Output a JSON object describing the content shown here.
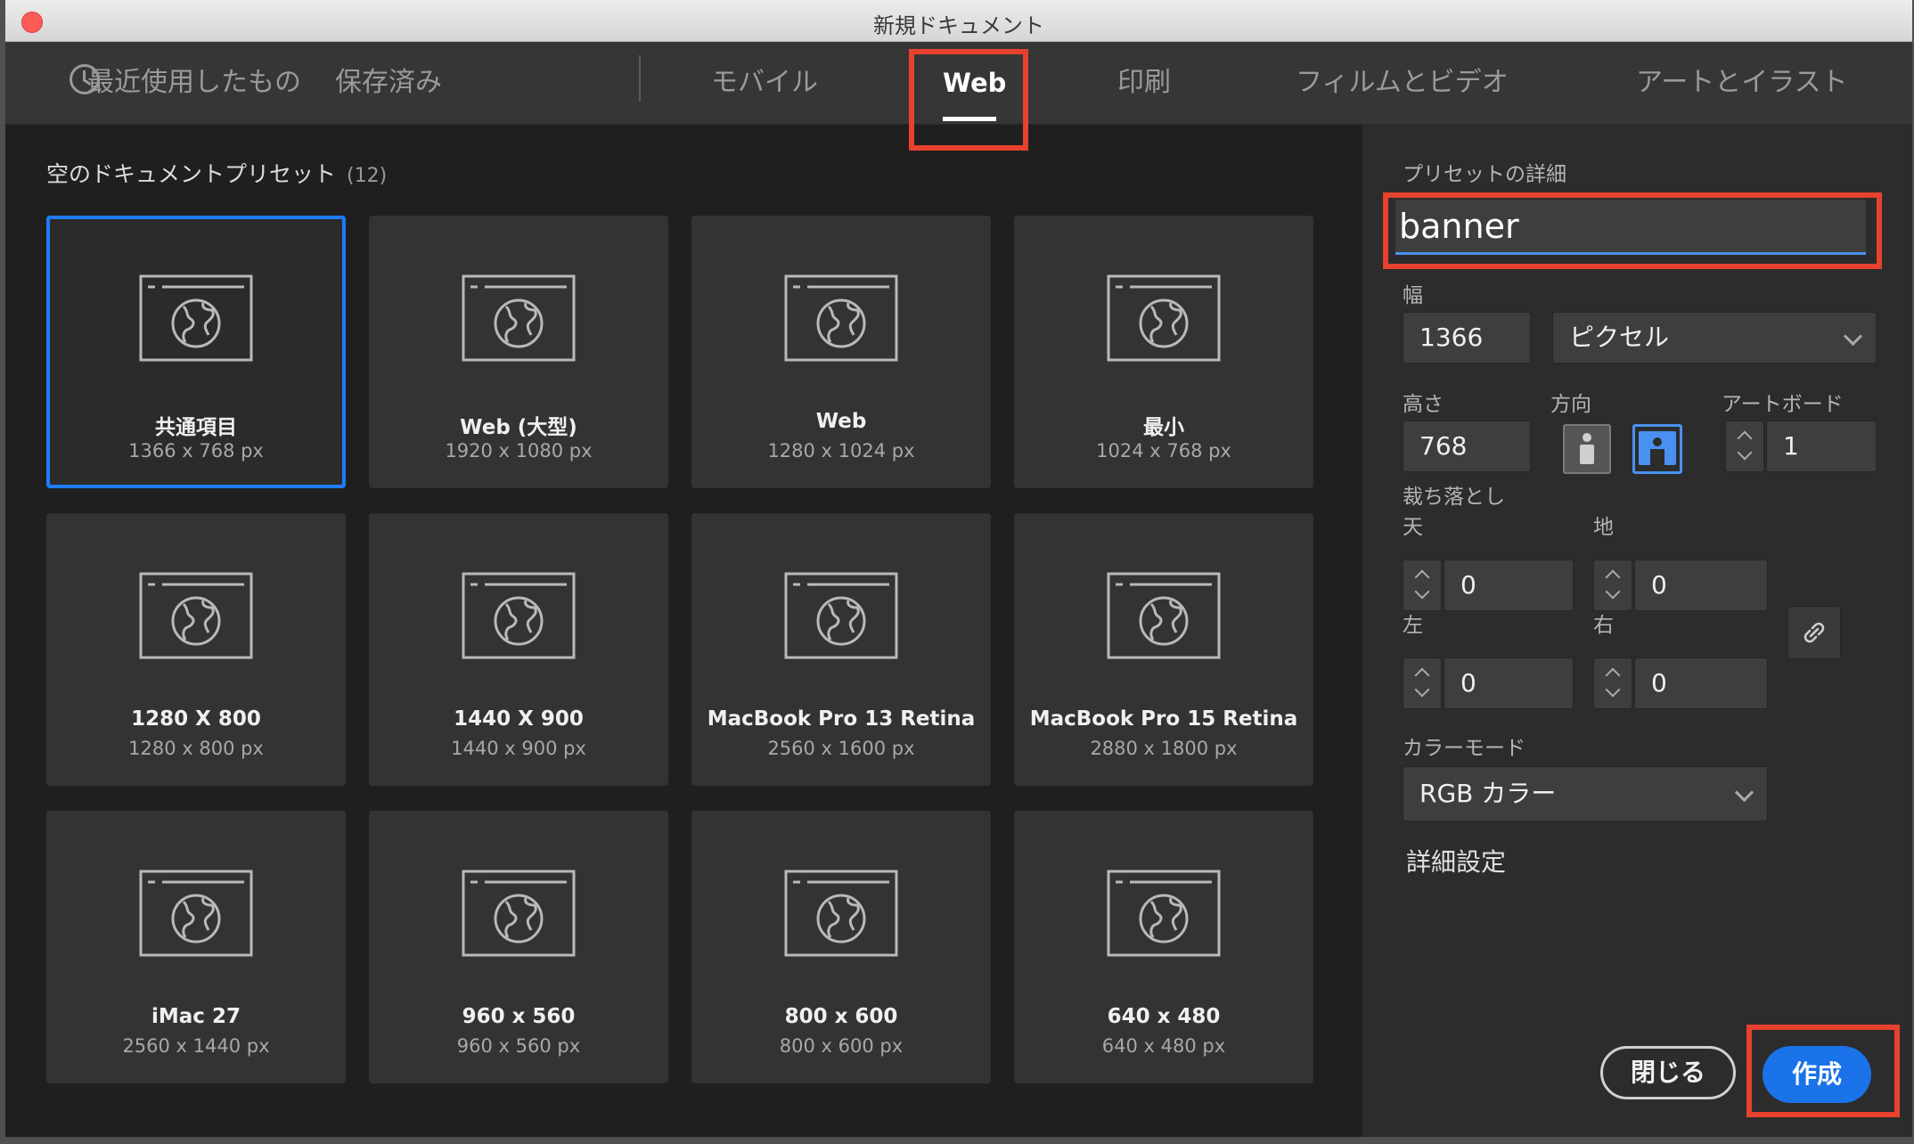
{
  "window": {
    "title": "新規ドキュメント"
  },
  "tabs": [
    {
      "label": "最近使用したもの",
      "icon": "clock-icon"
    },
    {
      "label": "保存済み"
    },
    {
      "label": "モバイル"
    },
    {
      "label": "Web",
      "active": true
    },
    {
      "label": "印刷"
    },
    {
      "label": "フィルムとビデオ"
    },
    {
      "label": "アートとイラスト"
    }
  ],
  "presets": {
    "title": "空のドキュメントプリセット",
    "count": "(12)",
    "items": [
      {
        "name": "共通項目",
        "size": "1366 x 768 px",
        "selected": true
      },
      {
        "name": "Web (大型)",
        "size": "1920 x 1080 px"
      },
      {
        "name": "Web",
        "size": "1280 x 1024 px"
      },
      {
        "name": "最小",
        "size": "1024 x 768 px"
      },
      {
        "name": "1280 X 800",
        "size": "1280 x 800 px"
      },
      {
        "name": "1440 X 900",
        "size": "1440 x 900 px"
      },
      {
        "name": "MacBook Pro 13 Retina",
        "size": "2560 x 1600 px"
      },
      {
        "name": "MacBook Pro 15 Retina",
        "size": "2880 x 1800 px"
      },
      {
        "name": "iMac 27",
        "size": "2560 x 1440 px"
      },
      {
        "name": "960 x 560",
        "size": "960 x 560 px"
      },
      {
        "name": "800 x 600",
        "size": "800 x 600 px"
      },
      {
        "name": "640 x 480",
        "size": "640 x 480 px"
      }
    ]
  },
  "details": {
    "title": "プリセットの詳細",
    "name_value": "banner",
    "width_label": "幅",
    "width_value": "1366",
    "unit_value": "ピクセル",
    "height_label": "高さ",
    "height_value": "768",
    "orientation_label": "方向",
    "artboard_label": "アートボード",
    "artboard_value": "1",
    "bleed_label": "裁ち落とし",
    "bleed_top_label": "天",
    "bleed_top_value": "0",
    "bleed_bottom_label": "地",
    "bleed_bottom_value": "0",
    "bleed_left_label": "左",
    "bleed_left_value": "0",
    "bleed_right_label": "右",
    "bleed_right_value": "0",
    "color_mode_label": "カラーモード",
    "color_mode_value": "RGB カラー",
    "advanced_label": "詳細設定"
  },
  "buttons": {
    "close_label": "閉じる",
    "create_label": "作成"
  },
  "colors": {
    "accent": "#1a73e8",
    "highlight": "#e8412e",
    "selected_border": "#1e7cf5"
  }
}
